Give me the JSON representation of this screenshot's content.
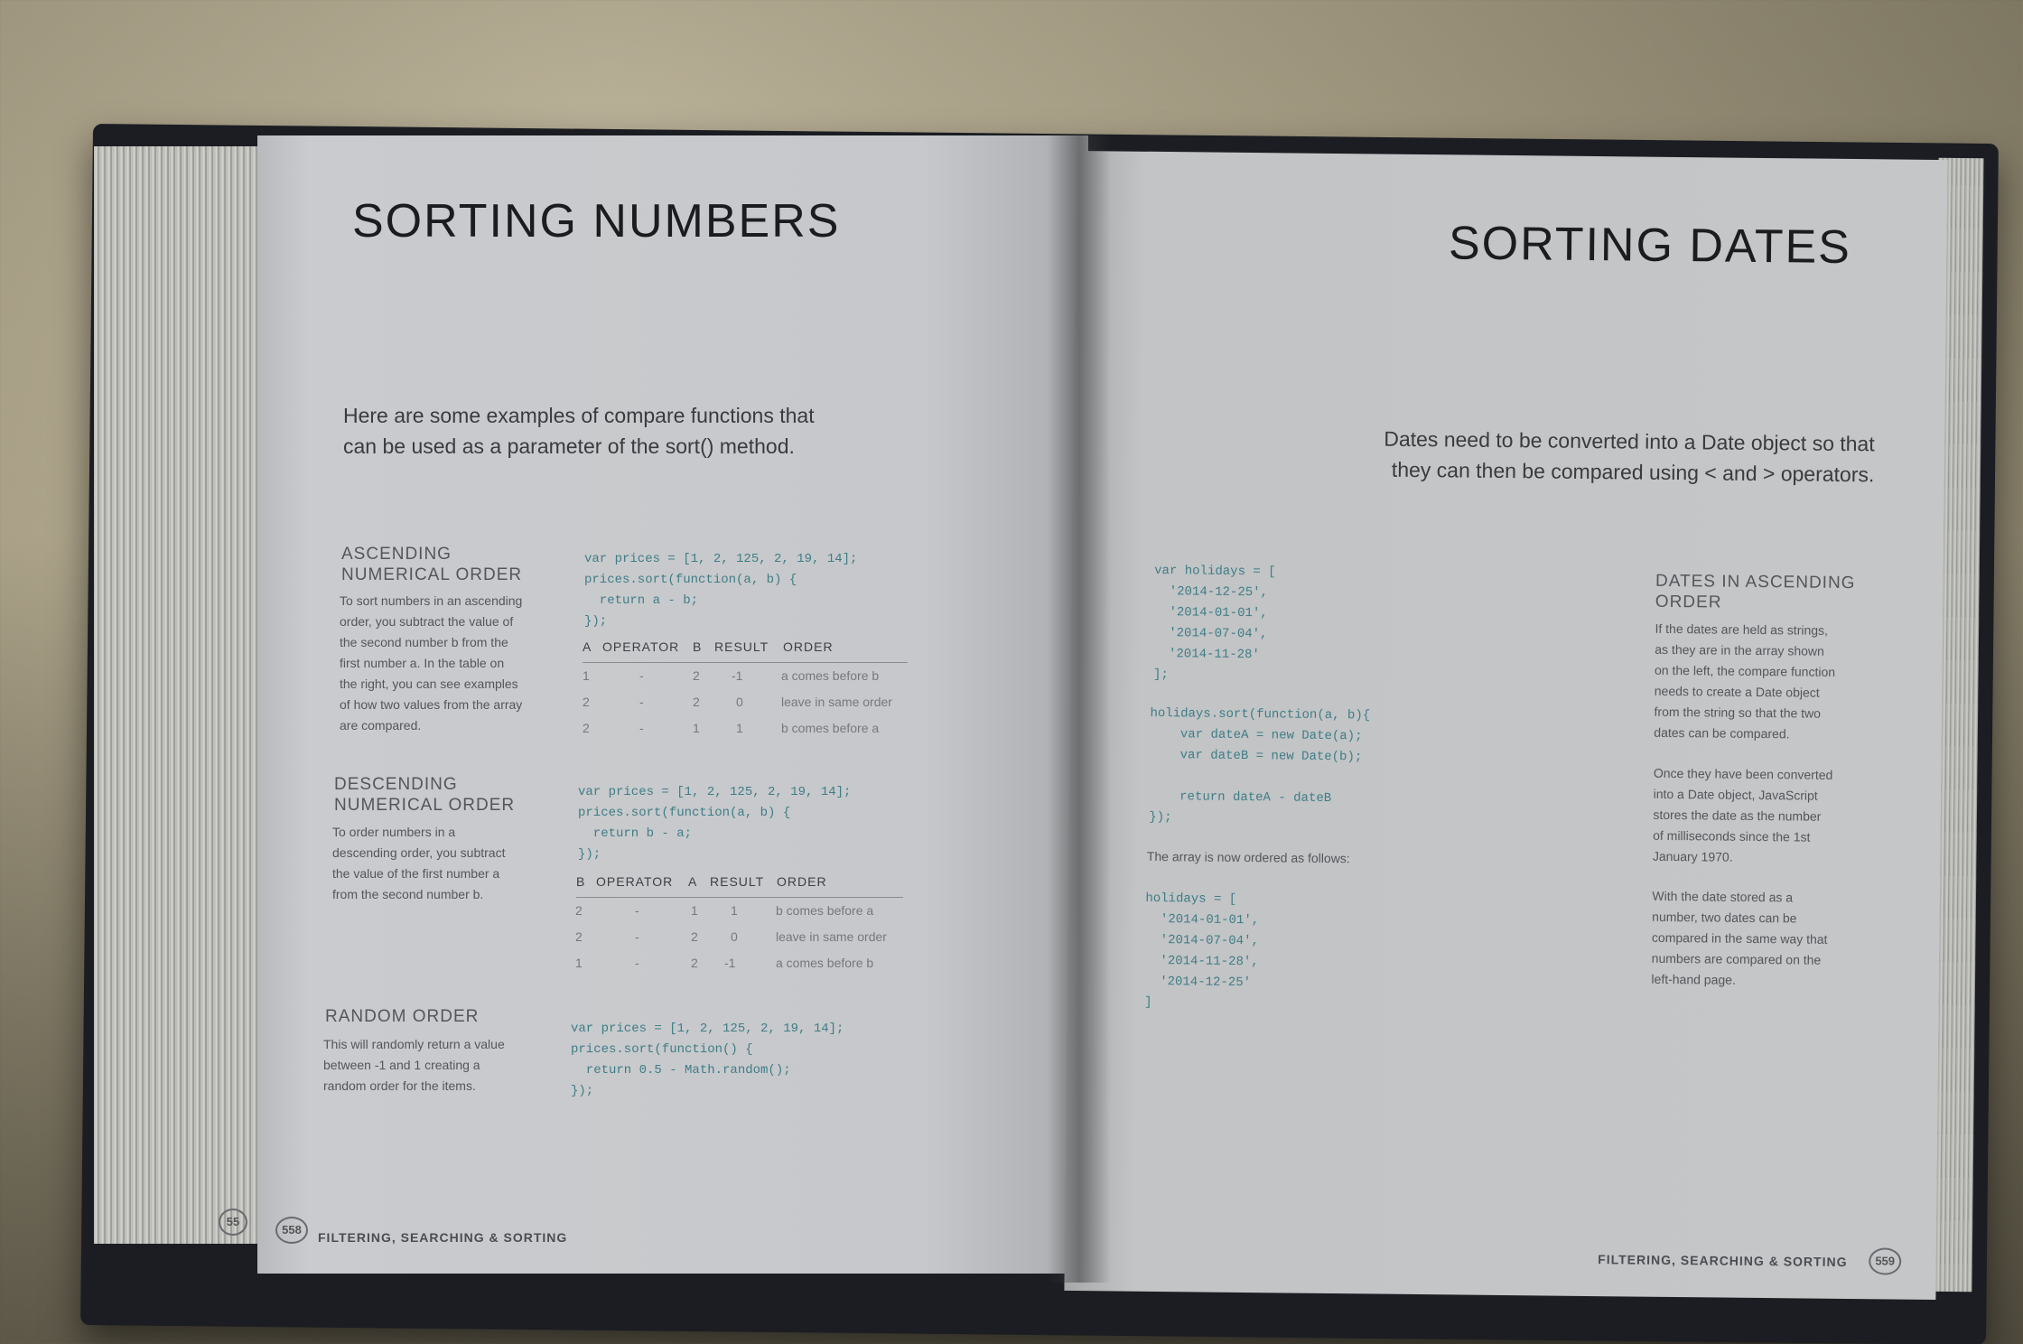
{
  "left_page": {
    "title": "SORTING NUMBERS",
    "intro_line1": "Here are some examples of compare functions that",
    "intro_line2": "can be used as a parameter of the sort() method.",
    "sections": [
      {
        "heading": [
          "ASCENDING",
          "NUMERICAL ORDER"
        ],
        "body": [
          "To sort numbers in an ascending",
          "order, you subtract the value of",
          "the second number b from the",
          "first number a. In the table on",
          "the right, you can see examples",
          "of how two values from the array",
          "are compared."
        ],
        "code": "var prices = [1, 2, 125, 2, 19, 14];\nprices.sort(function(a, b) {\n  return a - b;\n});",
        "table_head": [
          "a",
          "OPERATOR",
          "b",
          "RESULT",
          "ORDER"
        ],
        "rows": [
          [
            "1",
            "-",
            "2",
            "-1",
            "a comes before b"
          ],
          [
            "2",
            "-",
            "2",
            "0",
            "leave in same order"
          ],
          [
            "2",
            "-",
            "1",
            "1",
            "b comes before a"
          ]
        ]
      },
      {
        "heading": [
          "DESCENDING",
          "NUMERICAL ORDER"
        ],
        "body": [
          "To order numbers in a",
          "descending order, you subtract",
          "the value of the first number a",
          "from the second number b."
        ],
        "code": "var prices = [1, 2, 125, 2, 19, 14];\nprices.sort(function(a, b) {\n  return b - a;\n});",
        "table_head": [
          "b",
          "OPERATOR",
          "a",
          "RESULT",
          "ORDER"
        ],
        "rows": [
          [
            "2",
            "-",
            "1",
            "1",
            "b comes before a"
          ],
          [
            "2",
            "-",
            "2",
            "0",
            "leave in same order"
          ],
          [
            "1",
            "-",
            "2",
            "-1",
            "a comes before b"
          ]
        ]
      },
      {
        "heading": [
          "RANDOM ORDER"
        ],
        "body": [
          "This will randomly return a value",
          "between -1 and 1 creating a",
          "random order for the items."
        ],
        "code": "var prices = [1, 2, 125, 2, 19, 14];\nprices.sort(function() {\n  return 0.5 - Math.random();\n});"
      }
    ],
    "footer_pagenum": "558",
    "footer_prev_pagenum": "55",
    "footer_text": "FILTERING, SEARCHING & SORTING"
  },
  "right_page": {
    "title": "SORTING DATES",
    "intro_line1": "Dates need to be converted into a Date object so that",
    "intro_line2": "they can then be compared using < and > operators.",
    "code1": "var holidays = [\n  '2014-12-25',\n  '2014-01-01',\n  '2014-07-04',\n  '2014-11-28'\n];",
    "code2": "holidays.sort(function(a, b){\n    var dateA = new Date(a);\n    var dateB = new Date(b);\n\n    return dateA - dateB\n});",
    "ordered_label": "The array is now ordered as follows:",
    "code3": "holidays = [\n  '2014-01-01',\n  '2014-07-04',\n  '2014-11-28',\n  '2014-12-25'\n]",
    "side_heading": [
      "DATES IN ASCENDING",
      "ORDER"
    ],
    "side_para1": [
      "If the dates are held as strings,",
      "as they are in the array shown",
      "on the left, the compare function",
      "needs to create a Date object",
      "from the string so that the two",
      "dates can be compared."
    ],
    "side_para2": [
      "Once they have been converted",
      "into a Date object, JavaScript",
      "stores the date as the number",
      "of milliseconds since the 1st",
      "January 1970."
    ],
    "side_para3": [
      "With the date stored as a",
      "number, two dates can be",
      "compared in the same way that",
      "numbers are compared on the",
      "left-hand page."
    ],
    "footer_text": "FILTERING, SEARCHING & SORTING",
    "footer_pagenum": "559"
  }
}
